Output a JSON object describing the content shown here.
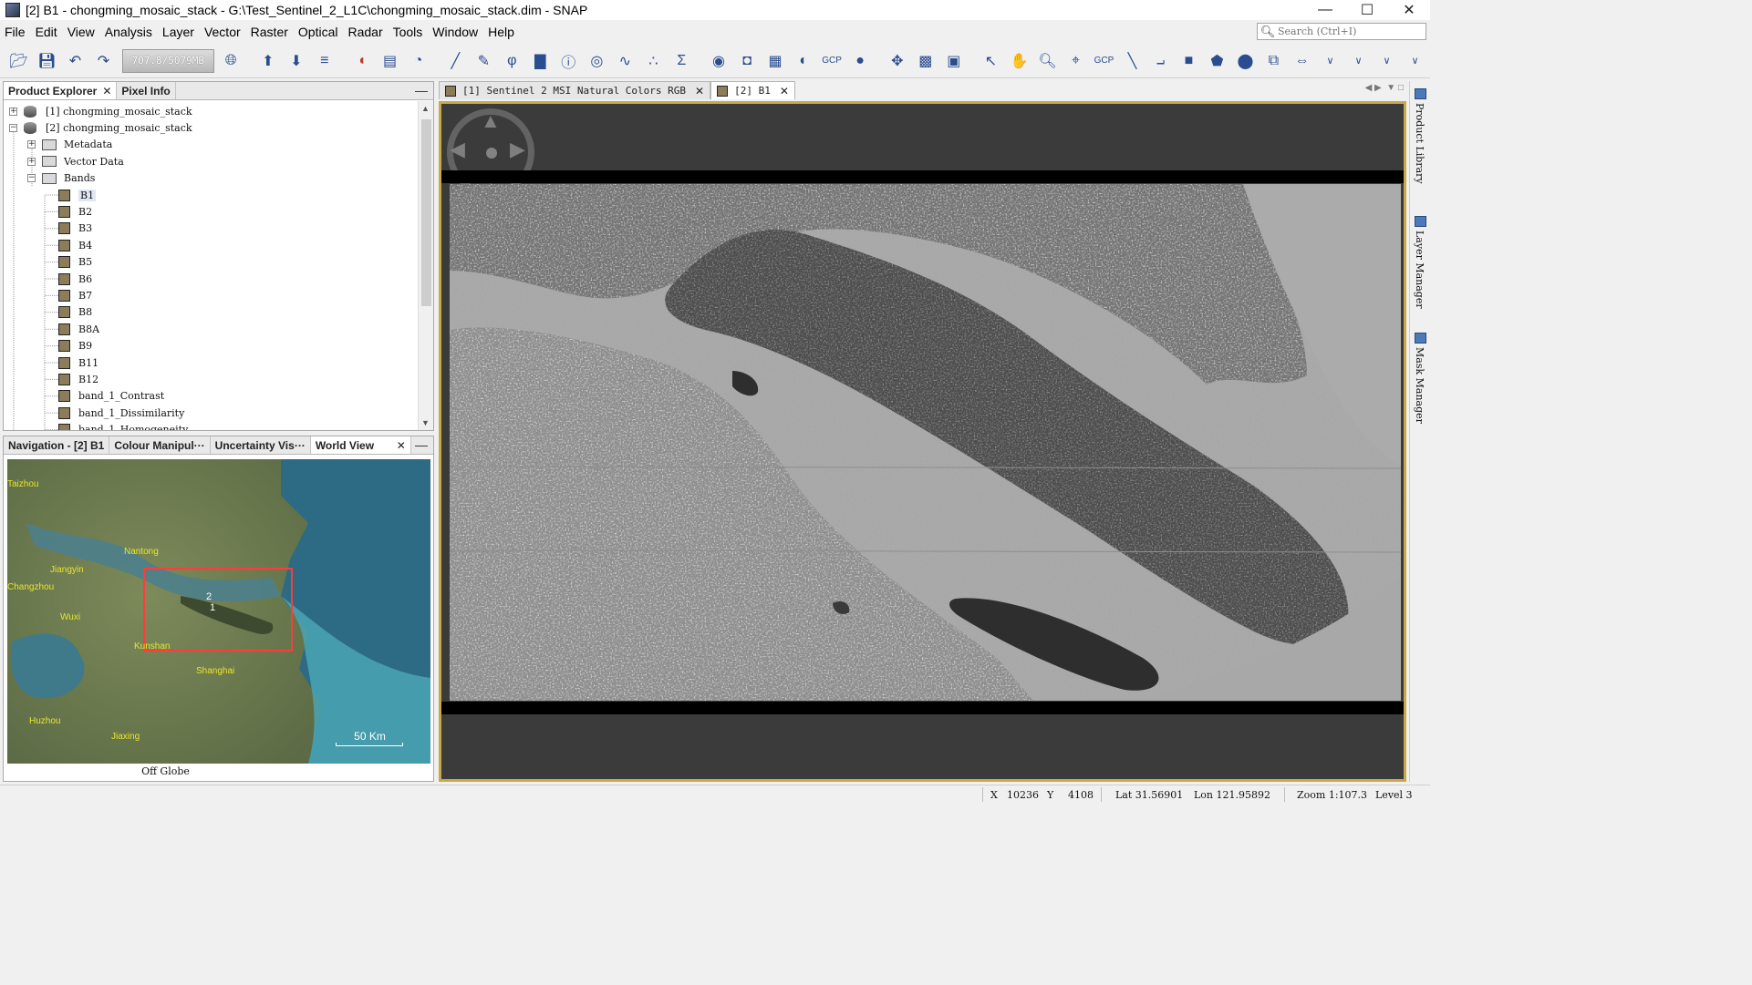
{
  "window": {
    "title": "[2] B1 - chongming_mosaic_stack - G:\\Test_Sentinel_2_L1C\\chongming_mosaic_stack.dim - SNAP",
    "minimize": "—",
    "maximize": "☐",
    "close": "✕"
  },
  "menus": [
    "File",
    "Edit",
    "View",
    "Analysis",
    "Layer",
    "Vector",
    "Raster",
    "Optical",
    "Radar",
    "Tools",
    "Window",
    "Help"
  ],
  "search": {
    "placeholder": "Search (Ctrl+I)"
  },
  "toolbar": {
    "memory": "707.8/5079MB"
  },
  "left_top": {
    "tabs": [
      {
        "label": "Product Explorer",
        "closable": true
      },
      {
        "label": "Pixel Info",
        "closable": false
      }
    ],
    "tree": {
      "products": [
        "[1]  chongming_mosaic_stack",
        "[2]  chongming_mosaic_stack"
      ],
      "folders": [
        "Metadata",
        "Vector Data",
        "Bands"
      ],
      "bands": [
        "B1",
        "B2",
        "B3",
        "B4",
        "B5",
        "B6",
        "B7",
        "B8",
        "B8A",
        "B9",
        "B11",
        "B12",
        "band_1_Contrast",
        "band_1_Dissimilarity",
        "band_1_Homogeneity"
      ]
    }
  },
  "left_bottom": {
    "tabs": [
      "Navigation - [2] B1",
      "Colour Manipul···",
      "Uncertainty Vis···",
      "World View"
    ],
    "cities": [
      "Taizhou",
      "Nantong",
      "Jiangyin",
      "Changzhou",
      "Wuxi",
      "Kunshan",
      "Shanghai",
      "Huzhou",
      "Jiaxing"
    ],
    "footprint_labels": [
      "2",
      "1"
    ],
    "scale": "50 Km",
    "globe_status": "Off Globe"
  },
  "main": {
    "tabs": [
      {
        "label": "[1] Sentinel 2 MSI Natural Colors RGB"
      },
      {
        "label": "[2] B1"
      }
    ]
  },
  "right_sidebar": [
    "Product Library",
    "Layer Manager",
    "Mask Manager"
  ],
  "status": {
    "x_label": "X",
    "x": "10236",
    "y_label": "Y",
    "y": "4108",
    "lat": "Lat 31.56901",
    "lon": "Lon 121.95892",
    "zoom": "Zoom 1:107.3",
    "level": "Level 3"
  },
  "colors": {
    "view_border": "#c9a84a",
    "footprint": "#ff3b3b",
    "city_label": "#e8e62a"
  }
}
